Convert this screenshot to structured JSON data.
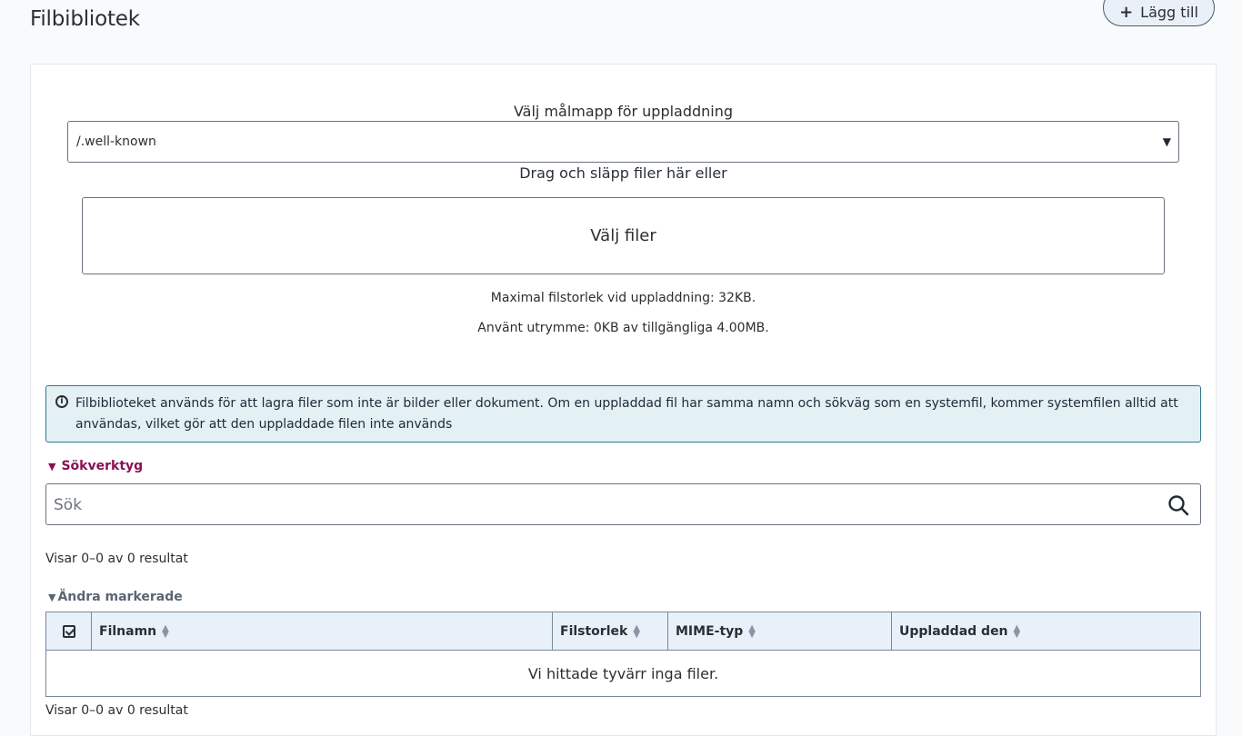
{
  "header": {
    "title": "Filbibliotek",
    "add_button_label": "Lägg till",
    "add_button_icon": "+"
  },
  "upload": {
    "folder_label": "Välj målmapp för uppladdning",
    "folder_selected": "/.well-known",
    "drop_label": "Drag och släpp filer här eller",
    "choose_files_label": "Välj filer",
    "max_size_text": "Maximal filstorlek vid uppladdning: 32KB.",
    "used_space_text": "Använt utrymme: 0KB av tillgängliga 4.00MB."
  },
  "info": {
    "icon": "info-icon",
    "text": "Filbiblioteket används för att lagra filer som inte är bilder eller dokument. Om en uppladdad fil har samma namn och sökväg som en systemfil, kommer systemfilen alltid att användas, vilket gör att den uppladdade filen inte används"
  },
  "search": {
    "toggle_label": "Sökverktyg",
    "placeholder": "Sök",
    "icon": "search-icon"
  },
  "results": {
    "top_count": "Visar 0–0 av 0 resultat",
    "bottom_count": "Visar 0–0 av 0 resultat",
    "bulk_toggle_label": "Ändra markerade"
  },
  "table": {
    "columns": [
      "Filnamn",
      "Filstorlek",
      "MIME-typ",
      "Uppladdad den"
    ],
    "empty_message": "Vi hittade tyvärr inga filer."
  },
  "colors": {
    "accent": "#8a1154",
    "info_bg": "#e3f0f4",
    "info_border": "#2f7a8a",
    "table_header_bg": "#e8f0fa"
  }
}
